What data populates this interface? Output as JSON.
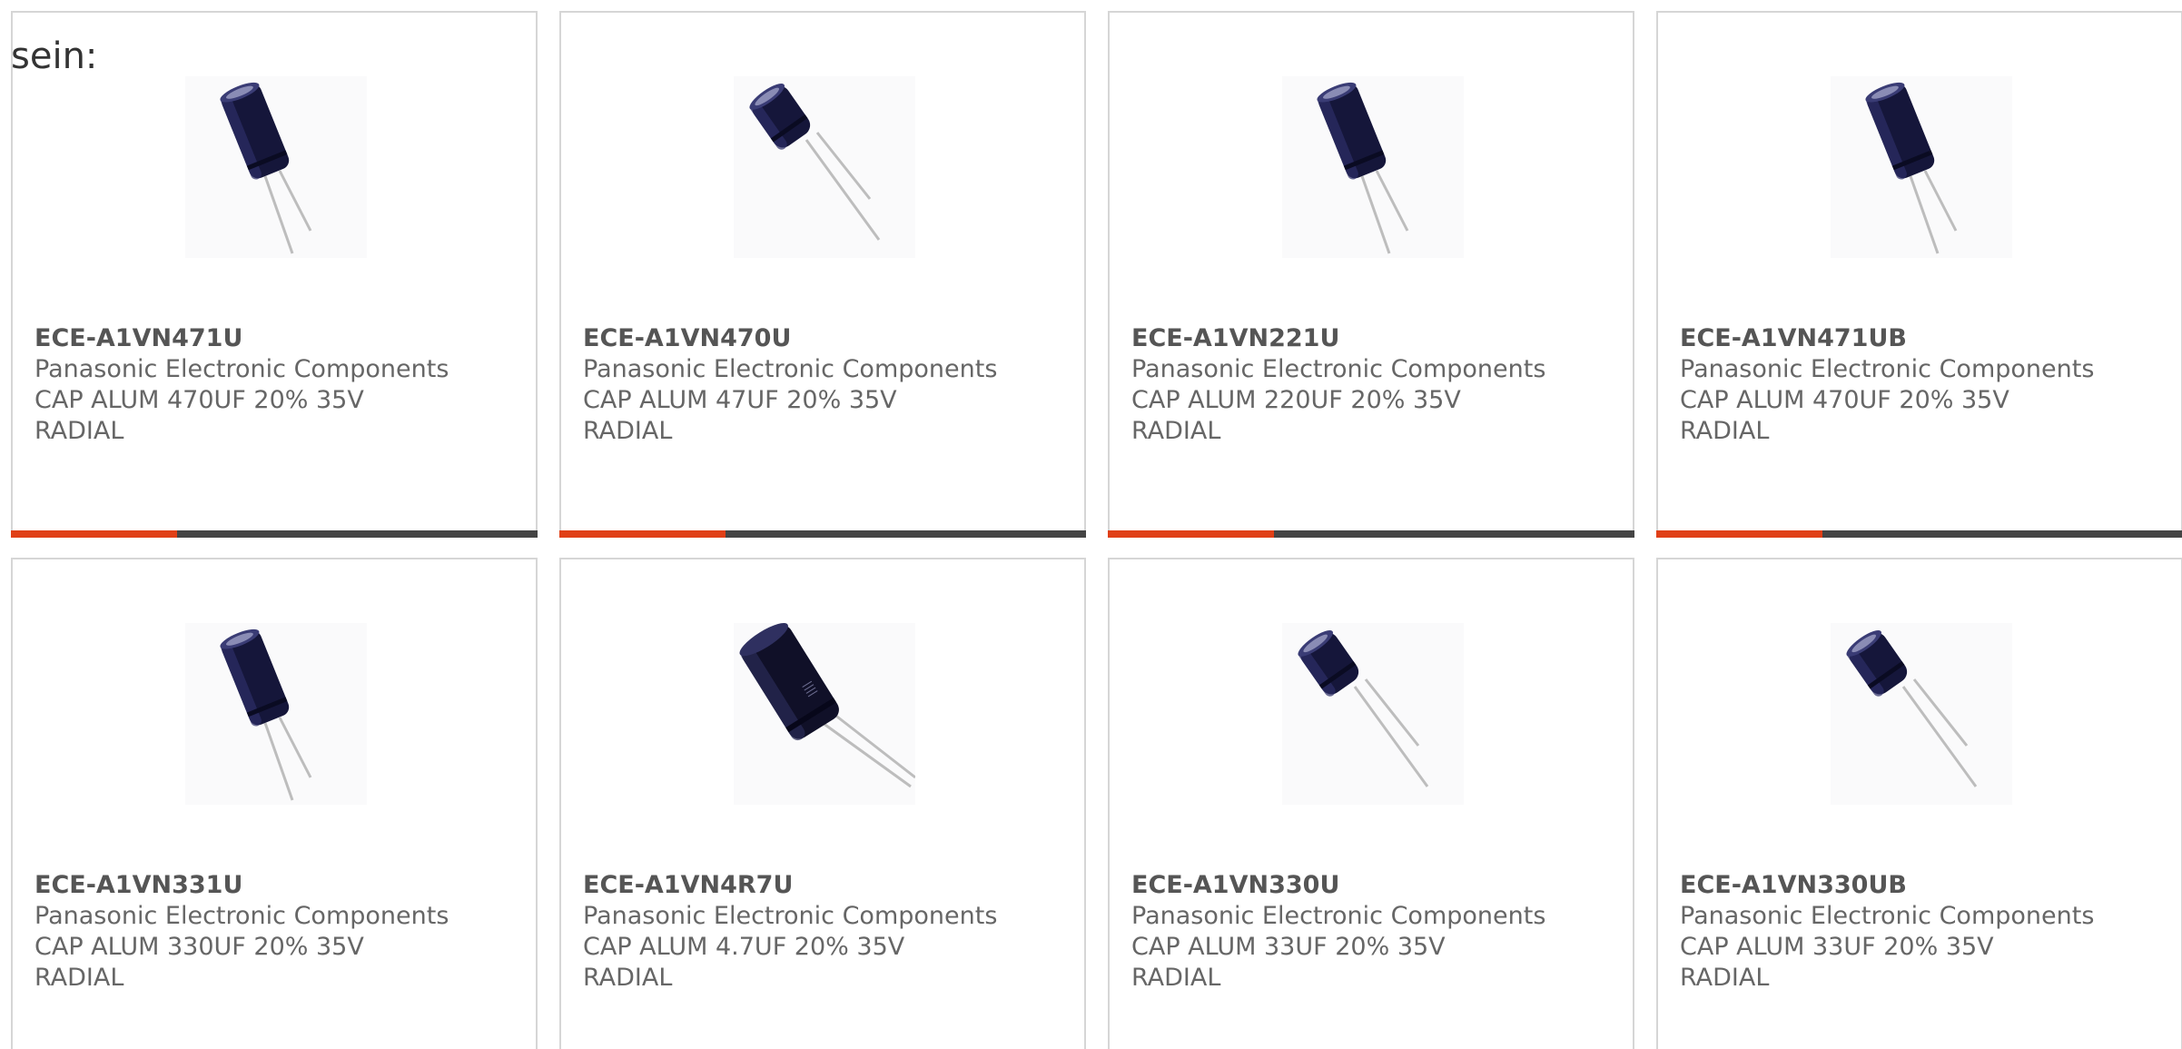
{
  "intro_text": "sein:",
  "colors": {
    "accent": "#e03f16",
    "bar": "#444444",
    "border": "#d6d6d6",
    "text": "#666666"
  },
  "products": [
    {
      "part_number": "ECE-A1VN471U",
      "manufacturer": "Panasonic Electronic Components",
      "desc_line1": "CAP ALUM 470UF 20% 35V",
      "desc_line2": "RADIAL",
      "image": "capacitor-tall-icon"
    },
    {
      "part_number": "ECE-A1VN470U",
      "manufacturer": "Panasonic Electronic Components",
      "desc_line1": "CAP ALUM 47UF 20% 35V",
      "desc_line2": "RADIAL",
      "image": "capacitor-short-icon"
    },
    {
      "part_number": "ECE-A1VN221U",
      "manufacturer": "Panasonic Electronic Components",
      "desc_line1": "CAP ALUM 220UF 20% 35V",
      "desc_line2": "RADIAL",
      "image": "capacitor-tall-icon"
    },
    {
      "part_number": "ECE-A1VN471UB",
      "manufacturer": "Panasonic Electronic Components",
      "desc_line1": "CAP ALUM 470UF 20% 35V",
      "desc_line2": "RADIAL",
      "image": "capacitor-tall-icon"
    },
    {
      "part_number": "ECE-A1VN331U",
      "manufacturer": "Panasonic Electronic Components",
      "desc_line1": "CAP ALUM 330UF 20% 35V",
      "desc_line2": "RADIAL",
      "image": "capacitor-tall-icon"
    },
    {
      "part_number": "ECE-A1VN4R7U",
      "manufacturer": "Panasonic Electronic Components",
      "desc_line1": "CAP ALUM 4.7UF 20% 35V",
      "desc_line2": "RADIAL",
      "image": "capacitor-large-icon"
    },
    {
      "part_number": "ECE-A1VN330U",
      "manufacturer": "Panasonic Electronic Components",
      "desc_line1": "CAP ALUM 33UF 20% 35V",
      "desc_line2": "RADIAL",
      "image": "capacitor-short-icon"
    },
    {
      "part_number": "ECE-A1VN330UB",
      "manufacturer": "Panasonic Electronic Components",
      "desc_line1": "CAP ALUM 33UF 20% 35V",
      "desc_line2": "RADIAL",
      "image": "capacitor-short-icon"
    }
  ]
}
